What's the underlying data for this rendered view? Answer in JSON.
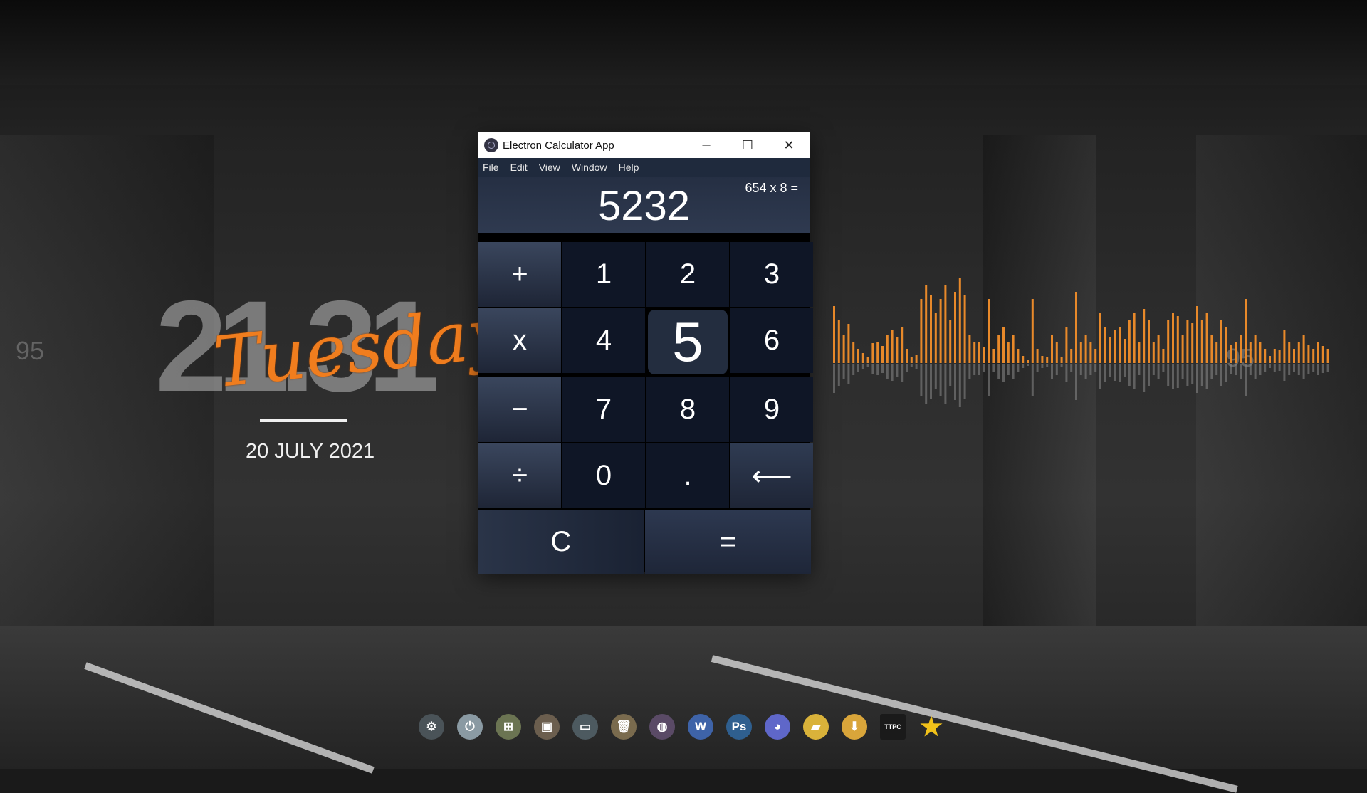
{
  "desktop": {
    "time": "21.31",
    "day": "Tuesday",
    "date": "20 JULY 2021",
    "edge_value": "95"
  },
  "window": {
    "title": "Electron Calculator App",
    "controls": {
      "minimize": "─",
      "maximize": "☐",
      "close": "✕"
    },
    "menu": [
      "File",
      "Edit",
      "View",
      "Window",
      "Help"
    ]
  },
  "calculator": {
    "result": "5232",
    "expression": "654 x 8 =",
    "keys": [
      {
        "label": "+",
        "kind": "op"
      },
      {
        "label": "1",
        "kind": "num"
      },
      {
        "label": "2",
        "kind": "num"
      },
      {
        "label": "3",
        "kind": "num"
      },
      {
        "label": "x",
        "kind": "op"
      },
      {
        "label": "4",
        "kind": "num"
      },
      {
        "label": "5",
        "kind": "active"
      },
      {
        "label": "6",
        "kind": "num"
      },
      {
        "label": "−",
        "kind": "op"
      },
      {
        "label": "7",
        "kind": "num"
      },
      {
        "label": "8",
        "kind": "num"
      },
      {
        "label": "9",
        "kind": "num"
      },
      {
        "label": "÷",
        "kind": "op"
      },
      {
        "label": "0",
        "kind": "num"
      },
      {
        "label": ".",
        "kind": "num"
      },
      {
        "label": "⟵",
        "kind": "back"
      }
    ],
    "clear": "C",
    "equals": "="
  },
  "dock": [
    {
      "name": "settings-icon",
      "glyph": "⚙",
      "color": "#4a5358"
    },
    {
      "name": "power-icon",
      "glyph": "⏻",
      "color": "#8a9aa3"
    },
    {
      "name": "windows-icon",
      "glyph": "⊞",
      "color": "#6b7452"
    },
    {
      "name": "window-icon",
      "glyph": "▣",
      "color": "#6b5e4e"
    },
    {
      "name": "monitor-icon",
      "glyph": "▭",
      "color": "#4d5a60"
    },
    {
      "name": "trash-icon",
      "glyph": "🗑",
      "color": "#7a6b4e"
    },
    {
      "name": "globe-icon",
      "glyph": "◍",
      "color": "#5a4a66"
    },
    {
      "name": "word-icon",
      "glyph": "W",
      "color": "#3e63a8"
    },
    {
      "name": "photoshop-icon",
      "glyph": "Ps",
      "color": "#2f5f8f"
    },
    {
      "name": "discord-icon",
      "glyph": "◕",
      "color": "#5f67c9"
    },
    {
      "name": "folder-icon",
      "glyph": "▰",
      "color": "#d9b23a"
    },
    {
      "name": "downloads-folder-icon",
      "glyph": "⬇",
      "color": "#d9a53a"
    },
    {
      "name": "ttpc-icon",
      "glyph": "TTPC",
      "color": "#1a1a1a"
    },
    {
      "name": "star-icon",
      "glyph": "★",
      "color": "#f2c21a"
    }
  ],
  "colors": {
    "accent": "#f07d1e",
    "visualizer": "#e8892a"
  }
}
